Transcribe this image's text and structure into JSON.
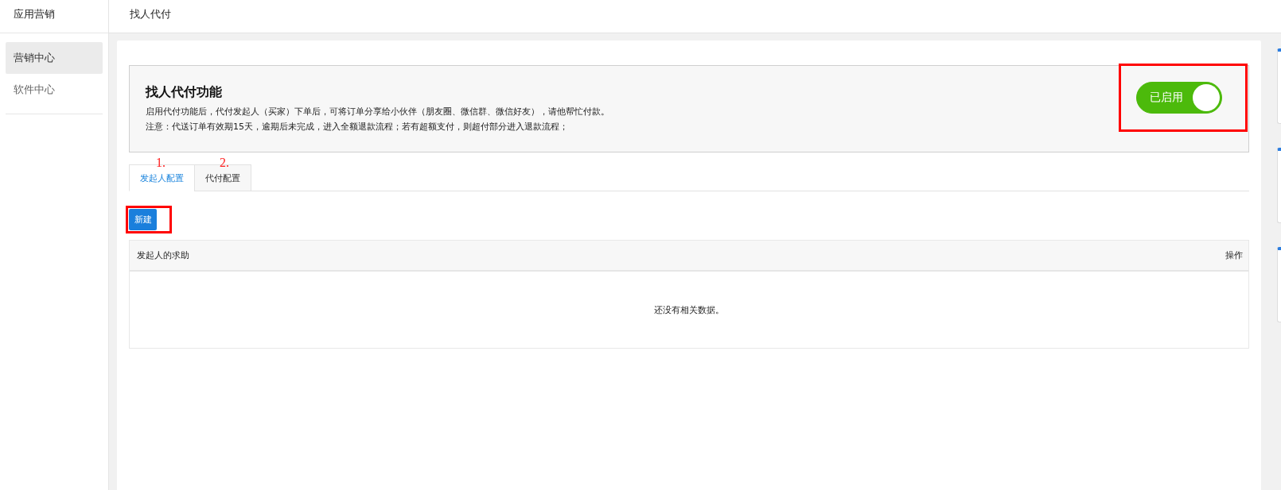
{
  "sidebar": {
    "title": "应用营销",
    "items": [
      {
        "label": "营销中心",
        "selected": true
      },
      {
        "label": "软件中心",
        "selected": false
      }
    ]
  },
  "header": {
    "title": "找人代付"
  },
  "feature": {
    "title": "找人代付功能",
    "description": "启用代付功能后，代付发起人（买家）下单后，可将订单分享给小伙伴（朋友圈、微信群、微信好友），请他帮忙付款。",
    "note": "注意：代送订单有效期15天，逾期后未完成，进入全额退款流程；若有超额支付，则超付部分进入退款流程；",
    "toggle": {
      "label": "已启用",
      "on": true,
      "highlighted": true
    }
  },
  "tabs": [
    {
      "label": "发起人配置",
      "selected": true,
      "annotation": "1."
    },
    {
      "label": "代付配置",
      "selected": false,
      "annotation": "2."
    }
  ],
  "new_button": {
    "label": "新建",
    "highlighted": true
  },
  "table": {
    "columns": [
      "发起人的求助",
      "操作"
    ],
    "empty_text": "还没有相关数据。"
  }
}
